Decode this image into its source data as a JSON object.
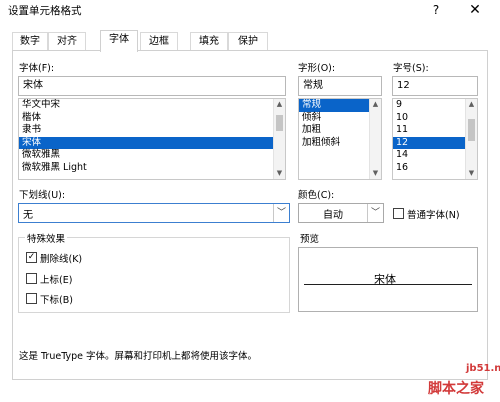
{
  "window": {
    "title": "设置单元格格式",
    "help": "?",
    "close": "✕"
  },
  "tabs": [
    {
      "label": "数字"
    },
    {
      "label": "对齐"
    },
    {
      "label": "字体"
    },
    {
      "label": "边框"
    },
    {
      "label": "填充"
    },
    {
      "label": "保护"
    }
  ],
  "font": {
    "label": "字体(F):",
    "value": "宋体",
    "items": [
      "华文中宋",
      "楷体",
      "隶书",
      "宋体",
      "微软雅黑",
      "微软雅黑 Light"
    ],
    "selected": "宋体"
  },
  "style": {
    "label": "字形(O):",
    "value": "常规",
    "items": [
      "常规",
      "倾斜",
      "加粗",
      "加粗倾斜"
    ],
    "selected": "常规"
  },
  "size": {
    "label": "字号(S):",
    "value": "12",
    "items": [
      "9",
      "10",
      "11",
      "12",
      "14",
      "16"
    ],
    "selected": "12"
  },
  "underline": {
    "label": "下划线(U):",
    "value": "无"
  },
  "color": {
    "label": "颜色(C):",
    "value": "自动",
    "normal_font_label": "普通字体(N)",
    "normal_font_checked": false
  },
  "effects": {
    "label": "特殊效果",
    "strikethrough": {
      "label": "删除线(K)",
      "checked": true
    },
    "superscript": {
      "label": "上标(E)",
      "checked": false
    },
    "subscript": {
      "label": "下标(B)",
      "checked": false
    }
  },
  "preview": {
    "label": "预览",
    "sample": "宋体"
  },
  "info": "这是 TrueType 字体。屏幕和打印机上都将使用该字体。",
  "watermark": {
    "url": "jb51.net",
    "name": "脚本之家"
  }
}
